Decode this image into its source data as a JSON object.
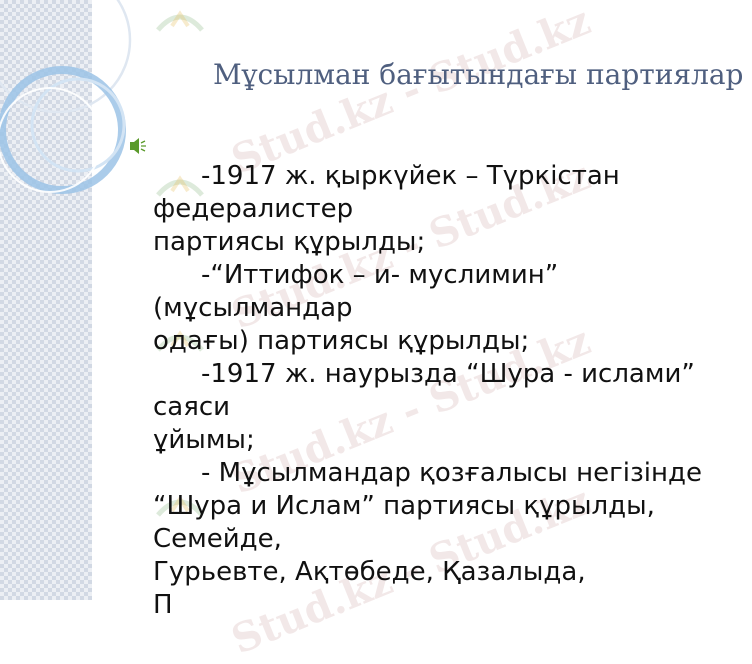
{
  "slide": {
    "title": "Мұсылман бағытындағы партиялар",
    "lines": [
      "-1917 ж. қыркүйек – Түркістан",
      "федералистер",
      "партиясы құрылды;",
      "-“Иттифок – и- муслимин”",
      "(мұсылмандар",
      "одағы) партиясы құрылды;",
      "-1917 ж. наурызда “Шура - ислами”",
      "саяси",
      "ұйымы;",
      "- Мұсылмандар қозғалысы негізінде",
      "“Шура и Ислам” партиясы құрылды,",
      "Семейде,",
      "Гурьевте, Ақтөбеде, Қазалыда,",
      "П"
    ]
  },
  "watermark": {
    "text": "Stud.kz - Stud.kz"
  },
  "colors": {
    "title": "#4f5f7f",
    "text": "#111111",
    "bullet": "#5a9a2a",
    "ring": "#9cc3e6",
    "watermark": "#c49696",
    "band": "#eceff4"
  },
  "icons": {
    "bullet": "speaker-bullet-icon",
    "watermark_logo": "stud-kz-logo-icon"
  }
}
